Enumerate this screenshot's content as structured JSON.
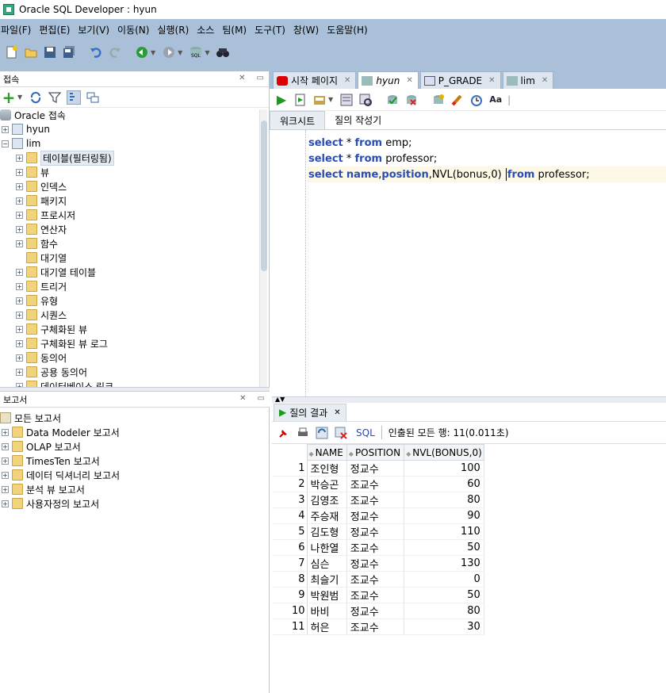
{
  "window": {
    "title": "Oracle SQL Developer : hyun"
  },
  "menu": [
    "파일(F)",
    "편집(E)",
    "보기(V)",
    "이동(N)",
    "실행(R)",
    "소스",
    "팀(M)",
    "도구(T)",
    "창(W)",
    "도움말(H)"
  ],
  "connections_panel": {
    "title": "접속",
    "root": "Oracle 접속",
    "nodes": [
      {
        "label": "hyun",
        "level": 1,
        "expanded": false
      },
      {
        "label": "lim",
        "level": 1,
        "expanded": true
      },
      {
        "label": "테이블(필터링됨)",
        "level": 2,
        "selected": true
      },
      {
        "label": "뷰",
        "level": 2
      },
      {
        "label": "인덱스",
        "level": 2
      },
      {
        "label": "패키지",
        "level": 2
      },
      {
        "label": "프로시저",
        "level": 2
      },
      {
        "label": "연산자",
        "level": 2
      },
      {
        "label": "함수",
        "level": 2
      },
      {
        "label": "대기열",
        "level": 2
      },
      {
        "label": "대기열 테이블",
        "level": 2
      },
      {
        "label": "트리거",
        "level": 2
      },
      {
        "label": "유형",
        "level": 2
      },
      {
        "label": "시퀀스",
        "level": 2
      },
      {
        "label": "구체화된 뷰",
        "level": 2
      },
      {
        "label": "구체화된 뷰 로그",
        "level": 2
      },
      {
        "label": "동의어",
        "level": 2
      },
      {
        "label": "공용 동의어",
        "level": 2
      },
      {
        "label": "데이터베이스 링크",
        "level": 2
      }
    ]
  },
  "reports_panel": {
    "title": "보고서",
    "root": "모든 보고서",
    "items": [
      "Data Modeler 보고서",
      "OLAP 보고서",
      "TimesTen 보고서",
      "데이터 딕셔너리 보고서",
      "분석 뷰 보고서",
      "사용자정의 보고서"
    ]
  },
  "editor_tabs": [
    {
      "label": "시작 페이지",
      "active": false
    },
    {
      "label": "hyun",
      "active": true
    },
    {
      "label": "P_GRADE",
      "active": false
    },
    {
      "label": "lim",
      "active": false
    }
  ],
  "sub_tabs": [
    "워크시트",
    "질의 작성기"
  ],
  "sql_lines": [
    {
      "kw1": "select",
      "mid": " * ",
      "kw2": "from",
      "rest": " emp;"
    },
    {
      "kw1": "select",
      "mid": " * ",
      "kw2": "from",
      "rest": " professor;"
    },
    {
      "kw1": "select",
      "mid": " ",
      "kw2": "from",
      "rest": " professor;"
    }
  ],
  "line3": {
    "kw1": "select",
    "name": "name",
    "comma1": ",",
    "position": "position",
    "comma2": ",",
    "func": "NVL(bonus,0)",
    "kw2": "from",
    "rest": " professor;"
  },
  "results": {
    "tab_label": "질의 결과",
    "sql_label": "SQL",
    "message": "인출된 모든 행: 11(0.011초)",
    "columns": [
      "NAME",
      "POSITION",
      "NVL(BONUS,0)"
    ],
    "rows": [
      [
        "1",
        "조인형",
        "정교수",
        "100"
      ],
      [
        "2",
        "박승곤",
        "조교수",
        "60"
      ],
      [
        "3",
        "김영조",
        "조교수",
        "80"
      ],
      [
        "4",
        "주승재",
        "정교수",
        "90"
      ],
      [
        "5",
        "김도형",
        "정교수",
        "110"
      ],
      [
        "6",
        "나한열",
        "조교수",
        "50"
      ],
      [
        "7",
        "심슨",
        "정교수",
        "130"
      ],
      [
        "8",
        "최슬기",
        "조교수",
        "0"
      ],
      [
        "9",
        "박원범",
        "조교수",
        "50"
      ],
      [
        "10",
        "바비",
        "정교수",
        "80"
      ],
      [
        "11",
        "허은",
        "조교수",
        "30"
      ]
    ]
  }
}
